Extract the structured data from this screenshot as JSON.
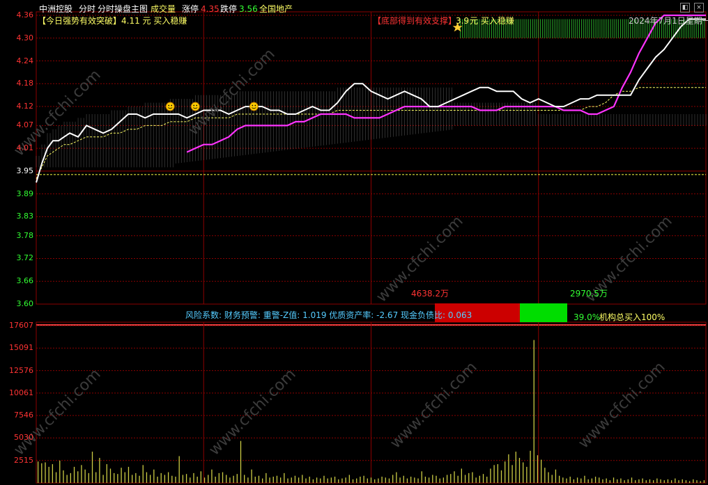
{
  "header": {
    "stock_name": "中洲控股",
    "mode": "分时",
    "indicator_name": "分时操盘主图",
    "volume_label": "成交量",
    "limit_up_label": "涨停",
    "limit_up_value": "4.35",
    "limit_down_label": "跌停",
    "limit_down_value": "3.56",
    "sector": "全国地产"
  },
  "signals": {
    "breakout_text": "【今日强势有效突破】",
    "breakout_price": "4.11 元 买入稳赚",
    "support_text": "【底部得到有效支撑】",
    "support_price": "3.9",
    "support_tail": "元 买入稳赚",
    "date": "2024年7月1日星期一"
  },
  "info_bar": {
    "risk": "风险系数: 财务预警: 重警-Z值: 1.019 优质资产率: -2.67 现金负债比: 0.063",
    "sell_amount": "4638.2万",
    "buy_amount": "2970.5万",
    "buy_pct": "39.0%",
    "institution": "机构总买入100%"
  },
  "colors": {
    "up": "#ff3333",
    "down": "#33ff33",
    "price_line": "#ffffff",
    "avg_line": "#ff33ff",
    "ma_line": "#ffff66",
    "grid": "#8b0000",
    "volume": "#cccc44"
  },
  "chart_data": [
    {
      "type": "line",
      "title": "分时",
      "y_ticks": [
        "4.36",
        "4.30",
        "4.24",
        "4.18",
        "4.12",
        "4.07",
        "4.01",
        "3.95",
        "3.89",
        "3.83",
        "3.78",
        "3.72",
        "3.66",
        "3.60"
      ],
      "ylim": [
        3.6,
        4.36
      ],
      "prev_close": 3.95,
      "grid": true,
      "x": [
        0,
        2,
        4,
        6,
        8,
        10,
        12,
        15,
        18,
        21,
        24,
        27,
        30,
        33,
        36,
        39,
        42,
        45,
        48,
        51,
        54,
        57,
        60,
        63,
        66,
        69,
        72,
        75,
        78,
        81,
        84,
        87,
        90,
        93,
        96,
        99,
        102,
        105,
        108,
        111,
        114,
        117,
        120,
        123,
        126,
        129,
        132,
        135,
        138,
        141,
        144,
        147,
        150,
        153,
        156,
        159,
        162,
        165,
        168,
        171,
        174,
        177,
        180,
        183,
        186,
        189,
        192,
        195,
        198,
        201,
        204,
        207,
        210,
        213,
        216,
        219,
        222,
        225,
        228,
        231,
        234,
        237,
        240
      ],
      "series": [
        {
          "values": [
            3.92,
            3.97,
            4.01,
            4.03,
            4.03,
            4.04,
            4.05,
            4.04,
            4.07,
            4.06,
            4.05,
            4.06,
            4.08,
            4.1,
            4.1,
            4.09,
            4.1,
            4.1,
            4.1,
            4.1,
            4.09,
            4.1,
            4.11,
            4.11,
            4.11,
            4.1,
            4.11,
            4.12,
            4.12,
            4.12,
            4.11,
            4.11,
            4.1,
            4.1,
            4.11,
            4.12,
            4.11,
            4.11,
            4.13,
            4.16,
            4.18,
            4.18,
            4.16,
            4.15,
            4.14,
            4.15,
            4.16,
            4.15,
            4.14,
            4.12,
            4.12,
            4.13,
            4.14,
            4.15,
            4.16,
            4.17,
            4.17,
            4.16,
            4.16,
            4.16,
            4.14,
            4.13,
            4.14,
            4.13,
            4.12,
            4.12,
            4.13,
            4.14,
            4.14,
            4.15,
            4.15,
            4.15,
            4.15,
            4.15,
            4.19,
            4.22,
            4.25,
            4.27,
            4.3,
            4.33,
            4.35,
            4.35,
            4.35
          ]
        },
        {
          "values": [
            null,
            null,
            null,
            null,
            null,
            null,
            null,
            null,
            null,
            null,
            null,
            null,
            null,
            null,
            null,
            null,
            null,
            null,
            null,
            null,
            4.0,
            4.01,
            4.02,
            4.02,
            4.03,
            4.04,
            4.06,
            4.07,
            4.07,
            4.07,
            4.07,
            4.07,
            4.07,
            4.08,
            4.08,
            4.09,
            4.1,
            4.1,
            4.1,
            4.1,
            4.09,
            4.09,
            4.09,
            4.09,
            4.1,
            4.11,
            4.12,
            4.12,
            4.12,
            4.12,
            4.12,
            4.12,
            4.12,
            4.12,
            4.12,
            4.11,
            4.11,
            4.11,
            4.12,
            4.12,
            4.12,
            4.12,
            4.12,
            4.12,
            4.12,
            4.11,
            4.11,
            4.11,
            4.1,
            4.1,
            4.11,
            4.12,
            4.17,
            4.21,
            4.26,
            4.3,
            4.34,
            4.36,
            4.36,
            4.36,
            4.36,
            4.36,
            4.36
          ]
        },
        {
          "values": [
            3.93,
            3.96,
            3.99,
            4.0,
            4.01,
            4.02,
            4.02,
            4.03,
            4.04,
            4.04,
            4.04,
            4.05,
            4.05,
            4.06,
            4.06,
            4.07,
            4.07,
            4.07,
            4.08,
            4.08,
            4.08,
            4.09,
            4.09,
            4.09,
            4.09,
            4.09,
            4.1,
            4.1,
            4.1,
            4.1,
            4.1,
            4.1,
            4.1,
            4.1,
            4.1,
            4.1,
            4.1,
            4.1,
            4.11,
            4.11,
            4.11,
            4.11,
            4.11,
            4.11,
            4.11,
            4.11,
            4.11,
            4.11,
            4.11,
            4.11,
            4.11,
            4.11,
            4.11,
            4.11,
            4.11,
            4.11,
            4.11,
            4.11,
            4.11,
            4.11,
            4.11,
            4.11,
            4.11,
            4.11,
            4.11,
            4.11,
            4.11,
            4.11,
            4.12,
            4.12,
            4.13,
            4.15,
            4.16,
            4.16,
            4.17,
            4.17,
            4.17,
            4.17,
            4.17,
            4.17,
            4.17,
            4.17,
            4.17
          ]
        }
      ]
    },
    {
      "type": "bar",
      "title": "成交量",
      "y_ticks": [
        "17607",
        "15091",
        "12576",
        "10061",
        "7546",
        "5030",
        "2515"
      ],
      "ylim": [
        0,
        17607
      ],
      "values": [
        2400,
        2200,
        2300,
        1800,
        2100,
        1200,
        2500,
        1400,
        900,
        1100,
        1800,
        1300,
        2000,
        1500,
        1100,
        3500,
        1200,
        2800,
        900,
        2100,
        1600,
        1100,
        1000,
        1700,
        1200,
        1800,
        900,
        1100,
        800,
        2000,
        1200,
        900,
        1500,
        700,
        1100,
        900,
        1200,
        800,
        700,
        3000,
        900,
        1000,
        600,
        1100,
        700,
        1300,
        600,
        900,
        1500,
        700,
        1100,
        1200,
        900,
        600,
        800,
        1000,
        4700,
        900,
        600,
        1500,
        700,
        800,
        500,
        1100,
        600,
        700,
        800,
        600,
        1100,
        500,
        600,
        800,
        600,
        900,
        500,
        700,
        400,
        600,
        500,
        800,
        500,
        600,
        700,
        400,
        500,
        600,
        900,
        400,
        500,
        700,
        800,
        500,
        600,
        400,
        500,
        700,
        600,
        500,
        900,
        1200,
        600,
        800,
        500,
        700,
        600,
        500,
        1300,
        700,
        600,
        900,
        800,
        500,
        600,
        900,
        1000,
        1300,
        800,
        1600,
        900,
        1100,
        1200,
        600,
        800,
        1000,
        700,
        1600,
        2000,
        2100,
        1400,
        2400,
        3200,
        2000,
        3500,
        2800,
        2300,
        1800,
        3600,
        16000,
        3100,
        2600,
        1700,
        1200,
        900,
        1500,
        800,
        600,
        500,
        700,
        400,
        600,
        500,
        800,
        400,
        500,
        700,
        600,
        400,
        500,
        300,
        600,
        400,
        500,
        300,
        400,
        600,
        300,
        400,
        500,
        300,
        400,
        300,
        500,
        400,
        300,
        400,
        300,
        500,
        300,
        400,
        300,
        200,
        400,
        300,
        200,
        300
      ]
    }
  ]
}
